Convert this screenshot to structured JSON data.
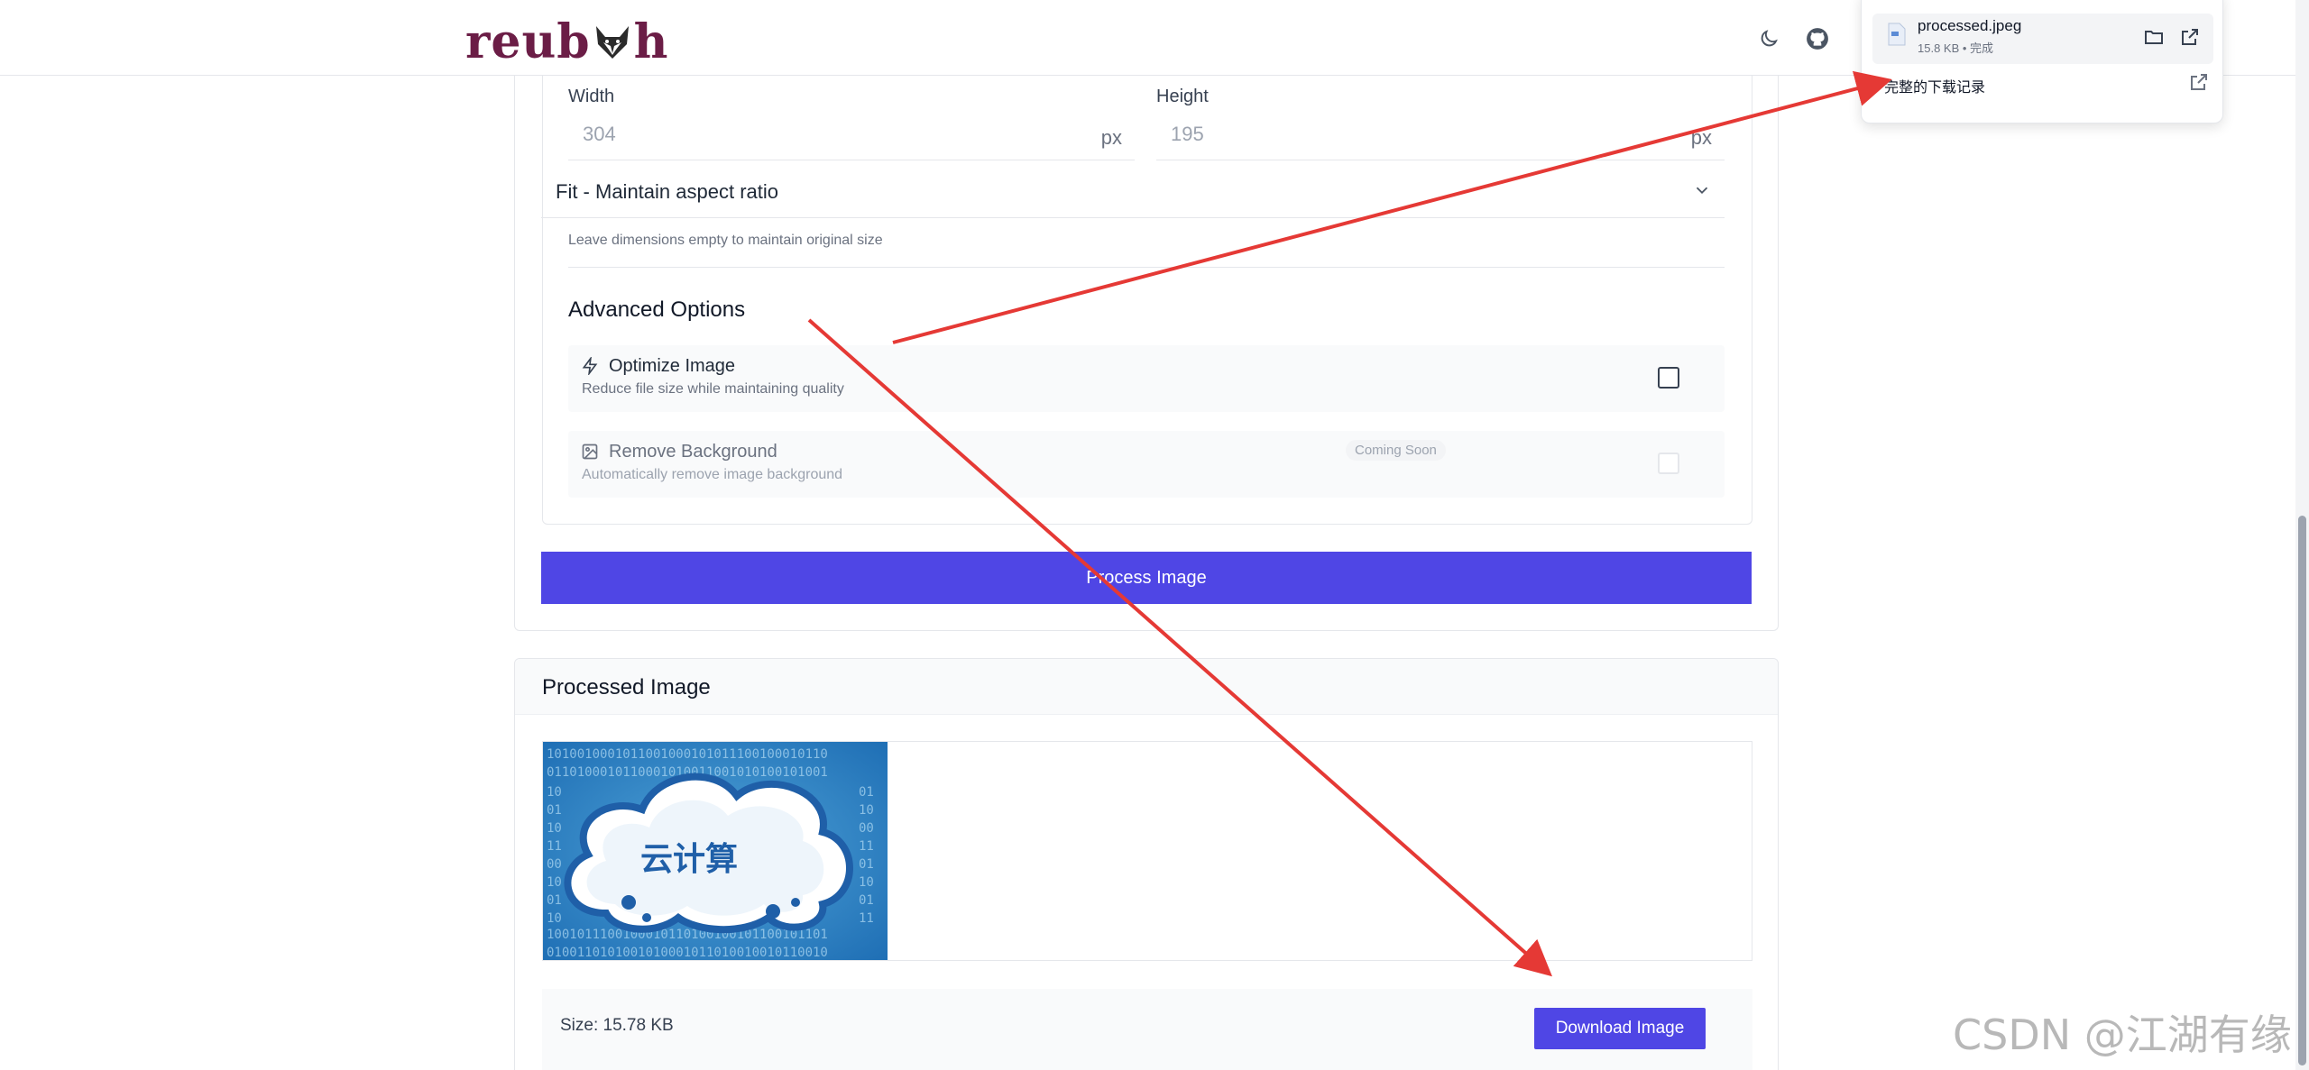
{
  "header": {
    "logo_text_left": "reub",
    "logo_text_right": "h",
    "moon_icon": "moon-icon",
    "github_icon": "github-icon"
  },
  "resize": {
    "width_label": "Width",
    "width_value": "304",
    "width_unit": "px",
    "height_label": "Height",
    "height_value": "195",
    "height_unit": "px",
    "fit_mode": "Fit - Maintain aspect ratio",
    "hint": "Leave dimensions empty to maintain original size"
  },
  "advanced": {
    "title": "Advanced Options",
    "optimize": {
      "title": "Optimize Image",
      "desc": "Reduce file size while maintaining quality",
      "checked": false
    },
    "remove_bg": {
      "title": "Remove Background",
      "badge": "Coming Soon",
      "desc": "Automatically remove image background",
      "checked": false
    }
  },
  "process_button": "Process Image",
  "processed": {
    "title": "Processed Image",
    "image_text": "云计算",
    "size_text": "Size: 15.78 KB",
    "download_button": "Download Image"
  },
  "downloads_popup": {
    "file_name": "processed.jpeg",
    "file_meta": "15.8 KB • 完成",
    "full_history": "完整的下载记录"
  },
  "watermark": "CSDN @江湖有缘",
  "colors": {
    "primary": "#4f46e5",
    "logo": "#6b1d46",
    "arrow": "#e53935"
  }
}
